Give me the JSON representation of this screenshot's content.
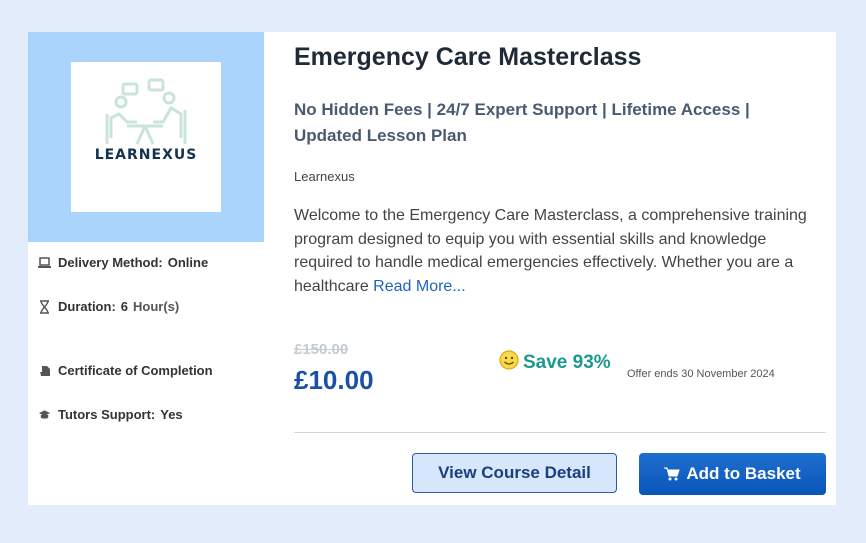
{
  "course": {
    "title": "Emergency Care Masterclass",
    "tagline": "No Hidden Fees | 24/7 Expert Support | Lifetime Access | Updated Lesson Plan",
    "provider": "Learnexus",
    "description": "Welcome to the Emergency Care Masterclass, a comprehensive training program designed to equip you with essential skills and knowledge required to handle medical emergencies effectively. Whether you are a healthcare",
    "read_more": "Read More..."
  },
  "logo": {
    "text": "LEARNEXUS"
  },
  "meta": {
    "delivery_label": "Delivery Method:",
    "delivery_value": "Online",
    "duration_label": "Duration:",
    "duration_value": "6",
    "duration_unit": "Hour(s)",
    "certificate": "Certificate of Completion",
    "tutors_label": "Tutors Support:",
    "tutors_value": "Yes"
  },
  "pricing": {
    "old_price": "£150.00",
    "price": "£10.00",
    "save": "Save 93%",
    "offer": "Offer ends 30 November 2024"
  },
  "buttons": {
    "detail": "View Course Detail",
    "basket": "Add to Basket"
  },
  "colors": {
    "page_bg": "#e3ecfa",
    "thumb_bg": "#aad4fb",
    "price": "#1a50a8",
    "save": "#1a9a8e",
    "basket_bg": "#0a55b8"
  },
  "icons": [
    "laptop-icon",
    "hourglass-icon",
    "certificate-icon",
    "graduation-cap-icon",
    "smiley-icon",
    "cart-icon"
  ]
}
